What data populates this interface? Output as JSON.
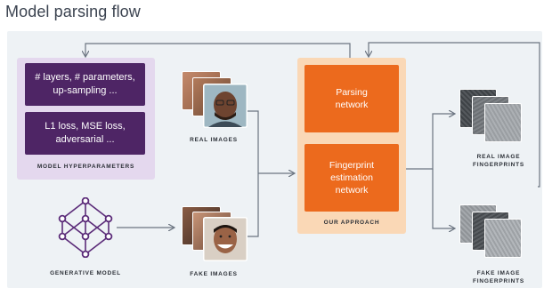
{
  "title": "Model parsing flow",
  "hyperparameters": {
    "box1": "# layers, # parameters,\nup-sampling ...",
    "box2": "L1 loss, MSE loss,\nadversarial ...",
    "caption": "MODEL HYPERPARAMETERS"
  },
  "generative_model": {
    "caption": "GENERATIVE MODEL"
  },
  "real_images": {
    "caption": "REAL IMAGES"
  },
  "fake_images": {
    "caption": "FAKE IMAGES"
  },
  "approach": {
    "box1": "Parsing\nnetwork",
    "box2": "Fingerprint\nestimation\nnetwork",
    "caption": "OUR APPROACH"
  },
  "real_fingerprints": {
    "caption": "REAL IMAGE\nFINGERPRINTS"
  },
  "fake_fingerprints": {
    "caption": "FAKE IMAGE\nFINGERPRINTS"
  },
  "colors": {
    "background": "#eef2f5",
    "hyper_panel": "#e4d8ee",
    "hyper_box": "#4e2565",
    "approach_panel": "#fad8b6",
    "approach_box": "#ec6a1d",
    "arrow": "#6b7480",
    "network_icon": "#5a2a78"
  }
}
